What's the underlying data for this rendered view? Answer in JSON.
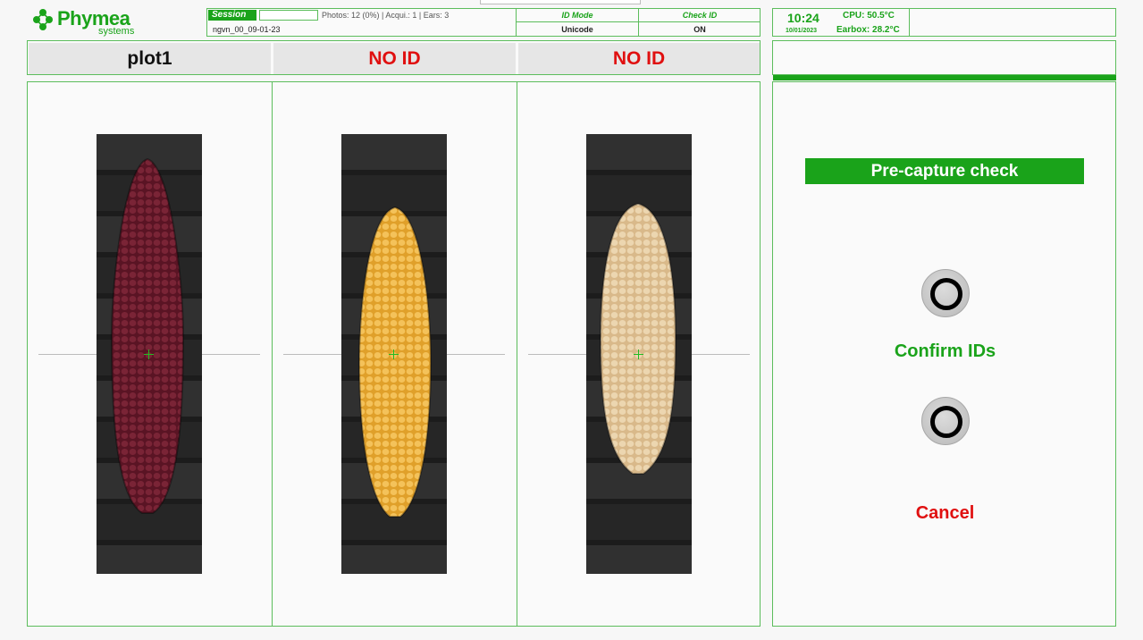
{
  "brand": {
    "name": "Phymea",
    "sub": "systems",
    "color": "#1aa31a"
  },
  "header": {
    "session_label": "Session",
    "stats": "Photos: 12 (0%) | Acqui.: 1 | Ears: 3",
    "session_name": "ngvn_00_09-01-23",
    "id_mode_label": "ID Mode",
    "id_mode_value": "Unicode",
    "check_id_label": "Check ID",
    "check_id_value": "ON"
  },
  "status": {
    "time": "10:24",
    "date": "10/01/2023",
    "cpu": "CPU: 50.5°C",
    "earbox": "Earbox: 28.2°C"
  },
  "ids": [
    {
      "label": "plot1",
      "state": "ok"
    },
    {
      "label": "NO ID",
      "state": "missing"
    },
    {
      "label": "NO ID",
      "state": "missing"
    }
  ],
  "images": [
    {
      "name": "ear-1",
      "kernel_color": "#5a1424",
      "kernel_highlight": "#7a2436"
    },
    {
      "name": "ear-2",
      "kernel_color": "#e0a02a",
      "kernel_highlight": "#f4c25a"
    },
    {
      "name": "ear-3",
      "kernel_color": "#d9b98a",
      "kernel_highlight": "#ecd6b0"
    }
  ],
  "controls": {
    "title": "Pre-capture check",
    "confirm_label": "Confirm IDs",
    "cancel_label": "Cancel"
  },
  "colors": {
    "accent": "#1aa31a",
    "alert": "#e01010",
    "border": "#5cbd5c"
  }
}
